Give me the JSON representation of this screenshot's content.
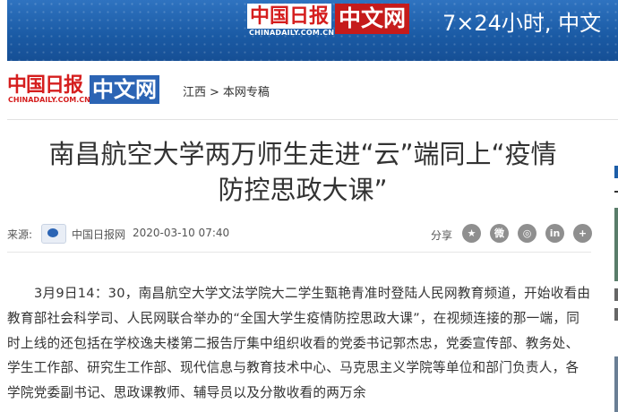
{
  "banner": {
    "logo_cn": "中国日报",
    "logo_url": "CHINADAILY.COM.CN",
    "logo_zw": "中文网",
    "slogan": "7×24小时, 中文"
  },
  "nav": {
    "logo_cn": "中国日报",
    "logo_url": "CHINADAILY.COM.CN",
    "logo_zw": "中文网",
    "breadcrumb_1": "江西",
    "breadcrumb_sep": ">",
    "breadcrumb_2": "本网专稿"
  },
  "article": {
    "title_line1": "南昌航空大学两万师生走进“云”端同上“疫情",
    "title_line2": "防控思政大课”",
    "source_label": "来源:",
    "source_name": "中国日报网",
    "date": "2020-03-10 07:40",
    "share_label": "分享",
    "share_icons": [
      "star-icon",
      "weibo-icon",
      "wechat-icon",
      "linkedin-icon",
      "plus-icon"
    ],
    "share_glyphs": [
      "★",
      "微",
      "◎",
      "in",
      "+"
    ],
    "body": "3月9日14：30，南昌航空大学文法学院大二学生甄艳青准时登陆人民网教育频道，开始收看由教育部社会科学司、人民网联合举办的“全国大学生疫情防控思政大课”，在视频连接的那一端，同时上线的还包括在学校逸夫楼第二报告厅集中组织收看的党委书记郭杰忠，党委宣传部、教务处、学生工作部、研究生工作部、现代信息与教育技术中心、马克思主义学院等单位和部门负责人，各学院党委副书记、思政课教师、辅导员以及分散收看的两万余"
  },
  "colors": {
    "brand_blue": "#1d5ea8",
    "brand_red": "#d51e1e",
    "share_grey": "#8f8f8f"
  }
}
